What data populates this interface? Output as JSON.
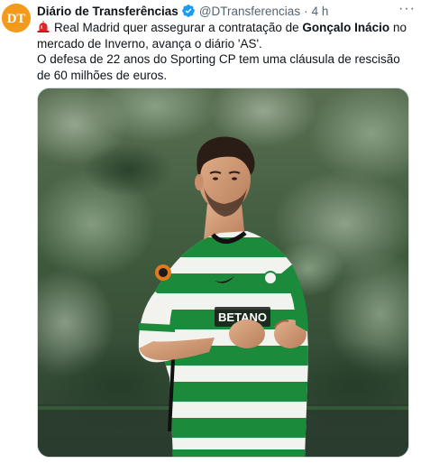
{
  "tweet": {
    "display_name": "Diário de Transferências",
    "handle": "@DTransferencias",
    "separator": "·",
    "time": "4 h",
    "more_label": "···",
    "avatar_icon": "dt-logo-icon",
    "avatar_text": "DT",
    "verified_icon": "verified-badge-icon",
    "text": {
      "line1_pre": "Real Madrid quer assegurar a contratação de ",
      "line1_bold": "Gonçalo Inácio",
      "line1_post": " no mercado de Inverno, avança o diário 'AS'.",
      "line2": "O defesa de 22 anos do Sporting CP tem uma cláusula de rescisão de 60 milhões de euros.",
      "siren_icon": "siren-icon"
    },
    "media": {
      "description_icon": "player-photo-image"
    }
  },
  "colors": {
    "avatar_bg": "#f39a1c",
    "verified": "#1d9bf0",
    "muted": "#536471",
    "jersey_green": "#1b8a3a"
  }
}
